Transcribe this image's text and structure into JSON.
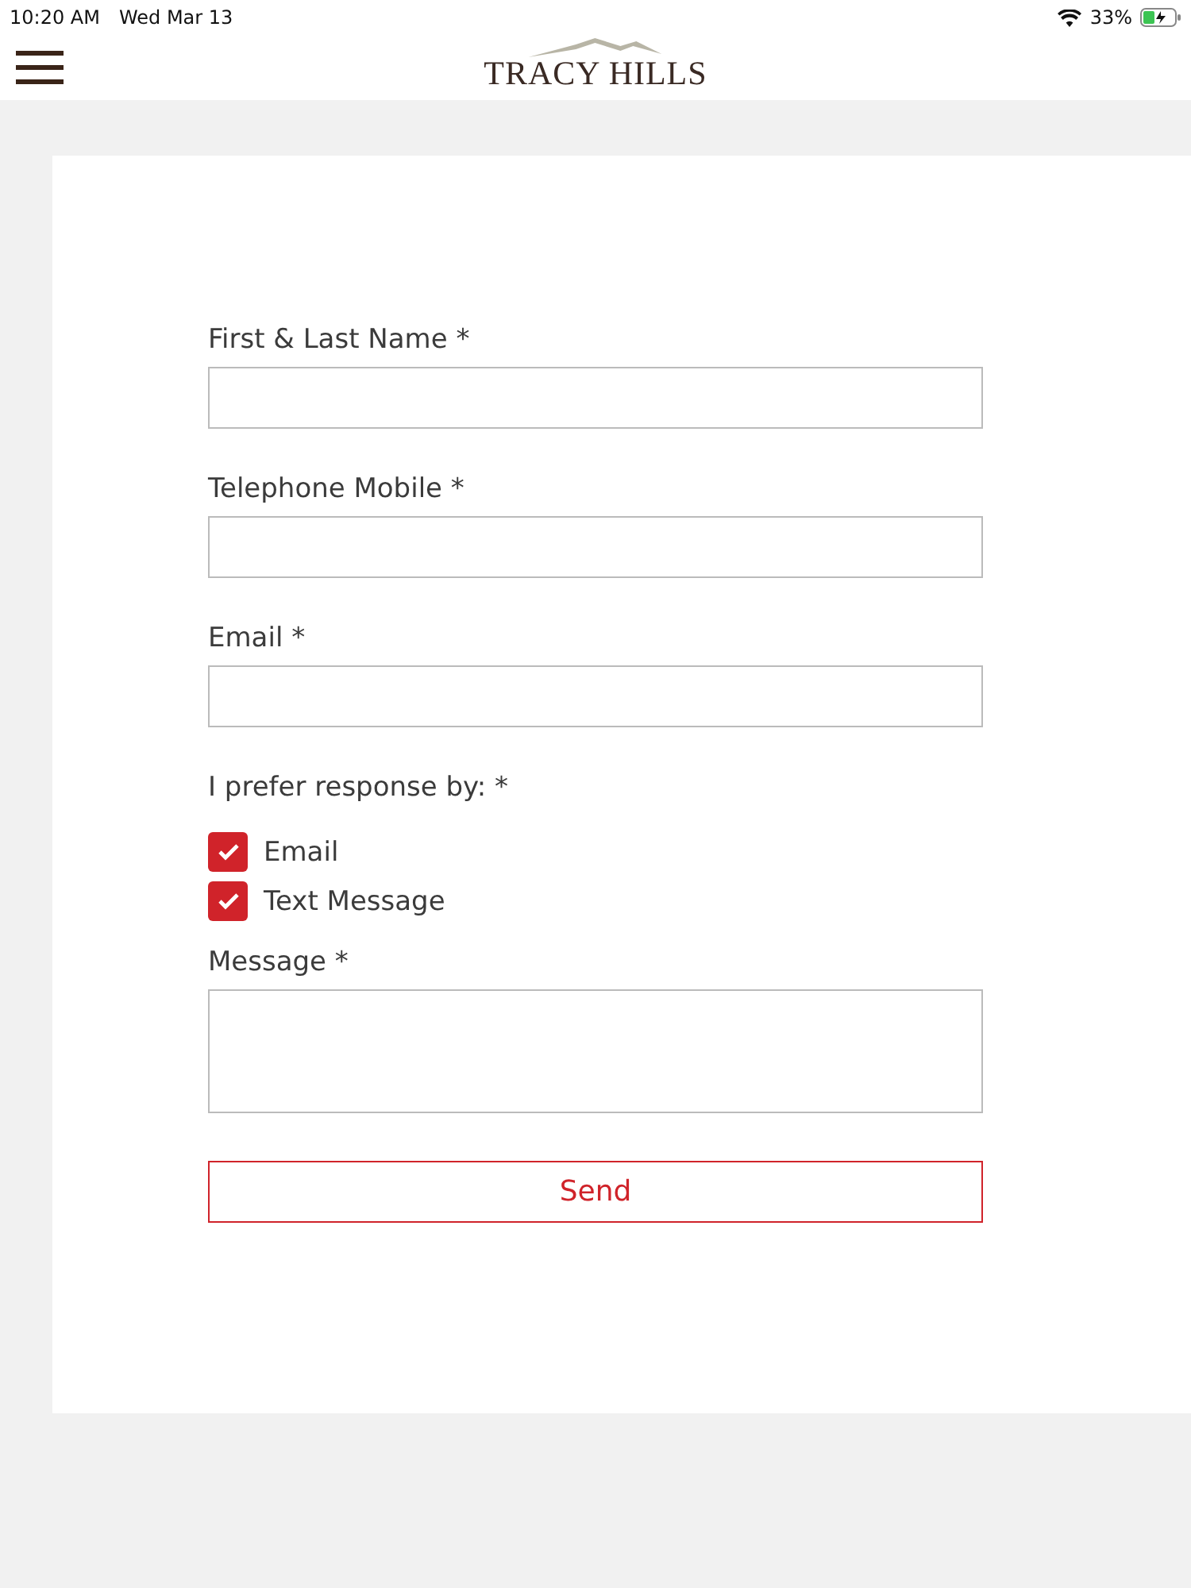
{
  "status_bar": {
    "time": "10:20 AM",
    "date": "Wed Mar 13",
    "battery": "33%"
  },
  "header": {
    "logo": "TRACY HILLS"
  },
  "form": {
    "fields": [
      {
        "kind": "input",
        "label": "First & Last Name *"
      },
      {
        "kind": "input",
        "label": "Telephone Mobile *"
      },
      {
        "kind": "input",
        "label": "Email *"
      },
      {
        "kind": "checks",
        "label": "I prefer response by: *",
        "options": [
          {
            "label": "Email",
            "checked": true
          },
          {
            "label": "Text Message",
            "checked": true
          }
        ]
      },
      {
        "kind": "textarea",
        "label": "Message *"
      }
    ],
    "submit": "Send"
  }
}
